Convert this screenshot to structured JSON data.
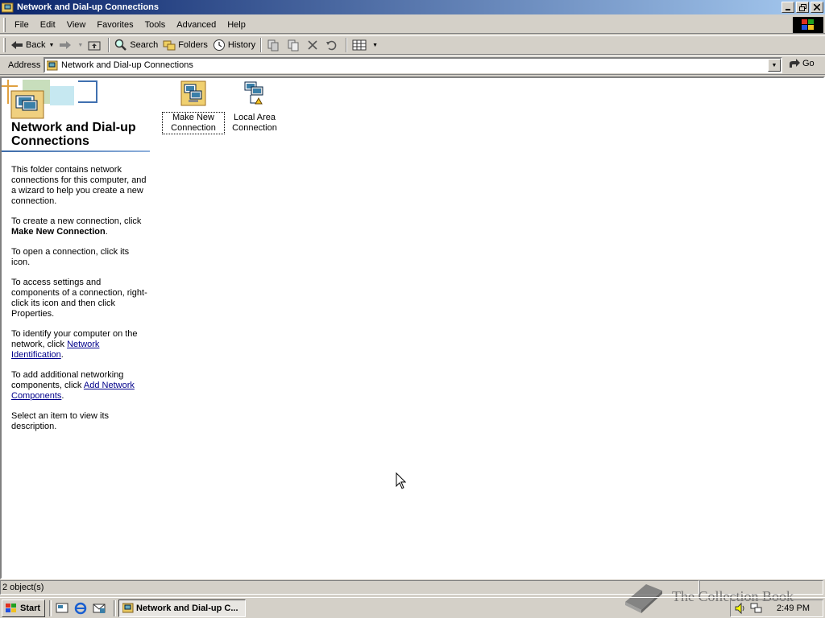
{
  "window": {
    "title": "Network and Dial-up Connections"
  },
  "menu": [
    "File",
    "Edit",
    "View",
    "Favorites",
    "Tools",
    "Advanced",
    "Help"
  ],
  "toolbar": {
    "back": "Back",
    "search": "Search",
    "folders": "Folders",
    "history": "History"
  },
  "address": {
    "label": "Address",
    "value": "Network and Dial-up Connections",
    "go": "Go"
  },
  "leftpane": {
    "title": "Network and Dial-up Connections",
    "p1": "This folder contains network connections for this computer, and a wizard to help you create a new connection.",
    "p2_pre": "To create a new connection, click",
    "p2_bold": "Make New Connection",
    "p2_post": ".",
    "p3": "To open a connection, click its icon.",
    "p4": "To access settings and components of a connection, right-click its icon and then click Properties.",
    "p5_pre": "To identify your computer on the network, click",
    "p5_link": "Network Identification",
    "p5_post": ".",
    "p6_pre": "To add additional networking components, click",
    "p6_link": "Add Network Components",
    "p6_post": ".",
    "p7": "Select an item to view its description."
  },
  "icons": [
    {
      "label": "Make New Connection",
      "icon": "make-new-connection-icon"
    },
    {
      "label": "Local Area Connection",
      "icon": "local-area-connection-icon"
    }
  ],
  "status": {
    "objects": "2 object(s)"
  },
  "watermark": "The Collection Book",
  "taskbar": {
    "start": "Start",
    "task": "Network and Dial-up C...",
    "clock": "2:49 PM"
  }
}
